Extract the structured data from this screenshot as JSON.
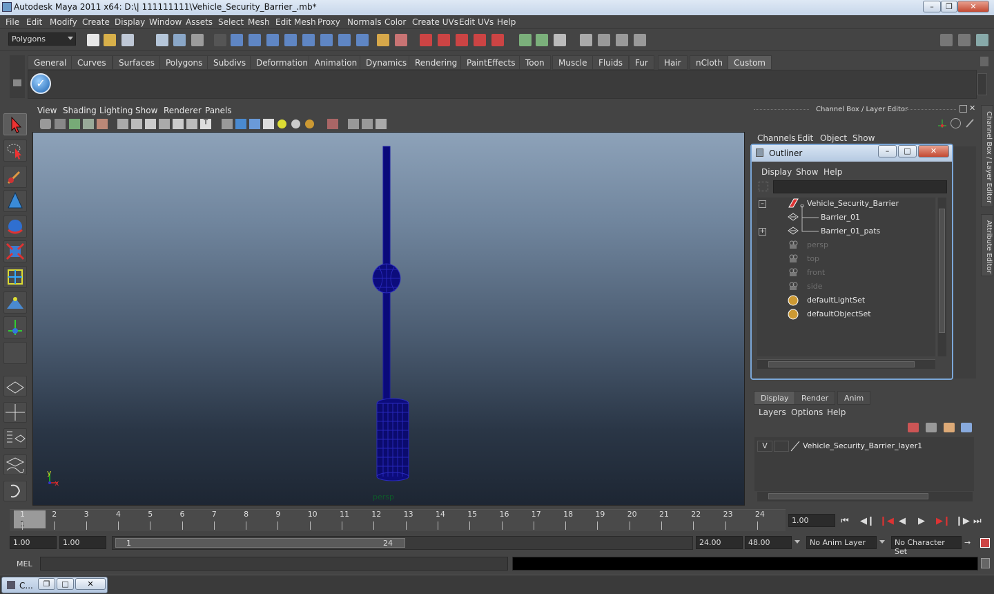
{
  "window": {
    "title": "Autodesk Maya 2011 x64: D:\\| 111111111\\Vehicle_Security_Barrier_.mb*",
    "minimize": "–",
    "maximize": "❐",
    "close": "✕"
  },
  "menubar": [
    "File",
    "Edit",
    "Modify",
    "Create",
    "Display",
    "Window",
    "Assets",
    "Select",
    "Mesh",
    "Edit Mesh",
    "Proxy",
    "Normals",
    "Color",
    "Create UVs",
    "Edit UVs",
    "Help"
  ],
  "mode_combo": "Polygons",
  "shelf_tabs": [
    "General",
    "Curves",
    "Surfaces",
    "Polygons",
    "Subdivs",
    "Deformation",
    "Animation",
    "Dynamics",
    "Rendering",
    "PaintEffects",
    "Toon",
    "Muscle",
    "Fluids",
    "Fur",
    "Hair",
    "nCloth",
    "Custom"
  ],
  "shelf_active_tab": "Custom",
  "viewport": {
    "menu": [
      "View",
      "Shading",
      "Lighting",
      "Show",
      "Renderer",
      "Panels"
    ],
    "camera_label": "persp",
    "axis_y": "y",
    "axis_x": "x"
  },
  "channel_box": {
    "title": "Channel Box / Layer Editor",
    "menu": [
      "Channels",
      "Edit",
      "Object",
      "Show"
    ]
  },
  "side_tabs": [
    "Channel Box / Layer Editor",
    "Attribute Editor"
  ],
  "outliner": {
    "title": "Outliner",
    "menu": [
      "Display",
      "Show",
      "Help"
    ],
    "items": [
      {
        "label": "Vehicle_Security_Barrier",
        "dim": false
      },
      {
        "label": "Barrier_01",
        "dim": false
      },
      {
        "label": "Barrier_01_pats",
        "dim": false
      },
      {
        "label": "persp",
        "dim": true
      },
      {
        "label": "top",
        "dim": true
      },
      {
        "label": "front",
        "dim": true
      },
      {
        "label": "side",
        "dim": true
      },
      {
        "label": "defaultLightSet",
        "dim": false
      },
      {
        "label": "defaultObjectSet",
        "dim": false
      }
    ]
  },
  "layer_editor": {
    "tabs": [
      "Display",
      "Render",
      "Anim"
    ],
    "active_tab": "Display",
    "menu": [
      "Layers",
      "Options",
      "Help"
    ],
    "layer": {
      "visible": "V",
      "name": "Vehicle_Security_Barrier_layer1"
    }
  },
  "timeline": {
    "ticks": [
      "1",
      "2",
      "3",
      "4",
      "5",
      "6",
      "7",
      "8",
      "9",
      "10",
      "11",
      "12",
      "13",
      "14",
      "15",
      "16",
      "17",
      "18",
      "19",
      "20",
      "21",
      "22",
      "23",
      "24"
    ],
    "current_frame_marker": "1",
    "current_time": "1.00"
  },
  "range": {
    "start": "1.00",
    "playback_start": "1.00",
    "slider_start": "1",
    "slider_end": "24",
    "playback_end": "24.00",
    "end": "48.00",
    "anim_layer": "No Anim Layer",
    "character_set": "No Character Set"
  },
  "command_line": {
    "label": "MEL"
  },
  "taskbar": {
    "item": "C..."
  }
}
